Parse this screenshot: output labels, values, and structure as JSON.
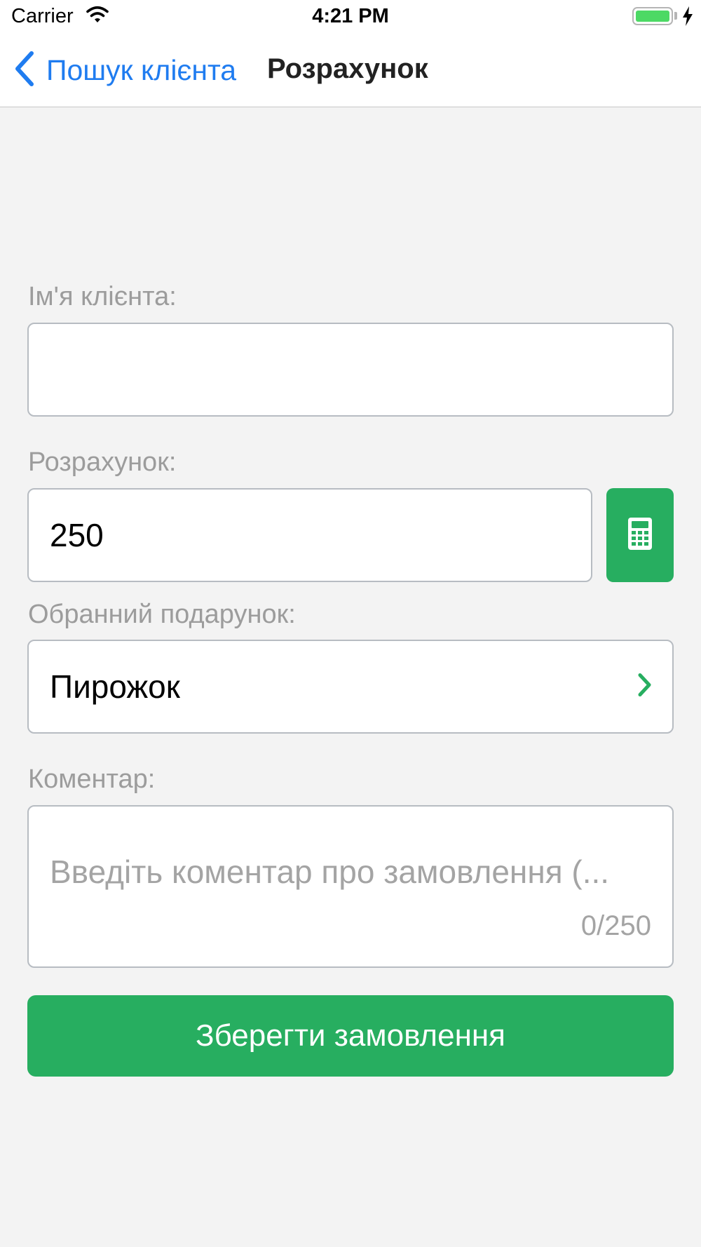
{
  "status_bar": {
    "carrier": "Carrier",
    "time": "4:21 PM",
    "icons": [
      "wifi-icon",
      "battery-icon",
      "charging-bolt-icon"
    ],
    "battery_color": "#4cd964"
  },
  "nav": {
    "back_label": "Пошук клієнта",
    "back_icon": "chevron-left-icon",
    "title": "Розрахунок",
    "accent_color": "#1f7cf0"
  },
  "form": {
    "client_name": {
      "label": "Ім'я клієнта:",
      "value": ""
    },
    "amount": {
      "label": "Розрахунок:",
      "value": "250",
      "calculator_icon": "calculator-icon"
    },
    "gift": {
      "label": "Обранний подарунок:",
      "value": "Пирожок",
      "chevron_icon": "chevron-right-icon"
    },
    "comment": {
      "label": "Коментар:",
      "placeholder": "Введіть коментар про замовлення (...",
      "counter": "0/250"
    }
  },
  "save_button": {
    "label": "Зберегти замовлення",
    "color": "#27ae60"
  }
}
